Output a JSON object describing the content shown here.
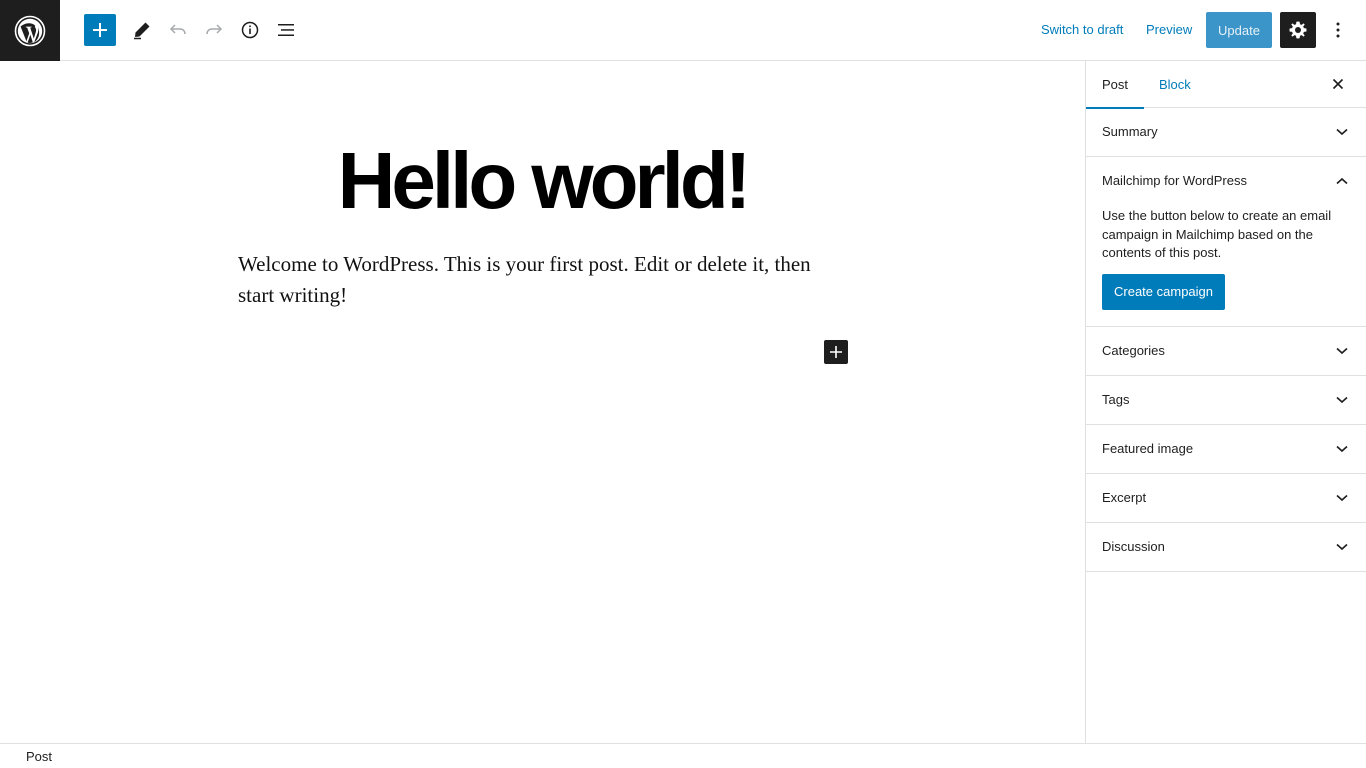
{
  "toolbar": {
    "logo_icon": "wordpress-logo-icon",
    "inserter_icon": "plus-icon",
    "tools_icon": "pencil-icon",
    "undo_icon": "undo-icon",
    "redo_icon": "redo-icon",
    "details_icon": "info-icon",
    "list_view_icon": "list-view-icon",
    "switch_to_draft": "Switch to draft",
    "preview": "Preview",
    "update": "Update",
    "settings_icon": "gear-icon",
    "more_icon": "more-vertical-icon",
    "accent": "#007cba"
  },
  "editor": {
    "title": "Hello world!",
    "content": "Welcome to WordPress. This is your first post. Edit or delete it, then start writing!",
    "block_inserter_icon": "plus-icon"
  },
  "sidebar": {
    "tabs": [
      {
        "label": "Post",
        "active": true
      },
      {
        "label": "Block",
        "active": false
      }
    ],
    "close_icon": "close-icon",
    "panels": [
      {
        "title": "Summary",
        "expanded": false
      },
      {
        "title": "Mailchimp for WordPress",
        "expanded": true,
        "description": "Use the button below to create an email campaign in Mailchimp based on the contents of this post.",
        "button": "Create campaign"
      },
      {
        "title": "Categories",
        "expanded": false
      },
      {
        "title": "Tags",
        "expanded": false
      },
      {
        "title": "Featured image",
        "expanded": false
      },
      {
        "title": "Excerpt",
        "expanded": false
      },
      {
        "title": "Discussion",
        "expanded": false
      }
    ]
  },
  "footer": {
    "breadcrumb": "Post"
  }
}
